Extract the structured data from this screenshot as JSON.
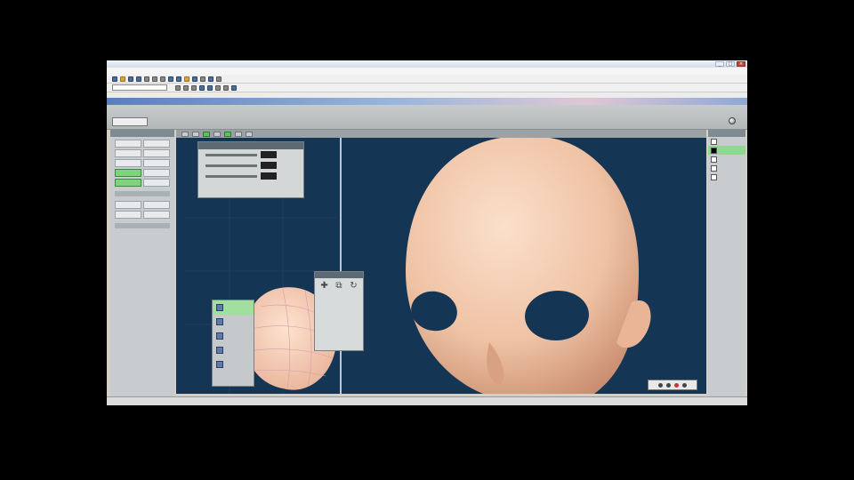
{
  "window": {
    "title": "",
    "controls": [
      "_",
      "□",
      "×"
    ]
  },
  "menus": [],
  "tab_strip": {
    "label": ""
  },
  "app": {
    "mode": "",
    "menu": [],
    "logo_text": ""
  },
  "view_bar": {
    "items": [
      "",
      "",
      "",
      "",
      "",
      "",
      ""
    ]
  },
  "left_panel": {
    "tabs": [
      "",
      ""
    ],
    "buttons": [
      "",
      "",
      "",
      "",
      "",
      "",
      "",
      "",
      "",
      "",
      "",
      "",
      "",
      ""
    ]
  },
  "float_dialog": {
    "title": "",
    "rows": [
      "",
      "",
      ""
    ]
  },
  "sub_panel": {
    "rows": [
      "",
      "",
      "",
      "",
      ""
    ]
  },
  "right_panel": {
    "rows": [
      "",
      "",
      "",
      "",
      ""
    ]
  },
  "status": {
    "left": "",
    "right": ""
  },
  "colors": {
    "viewport_bg": "#143553",
    "skin": "#f5cfb4",
    "accent_green": "#7fd37f"
  }
}
